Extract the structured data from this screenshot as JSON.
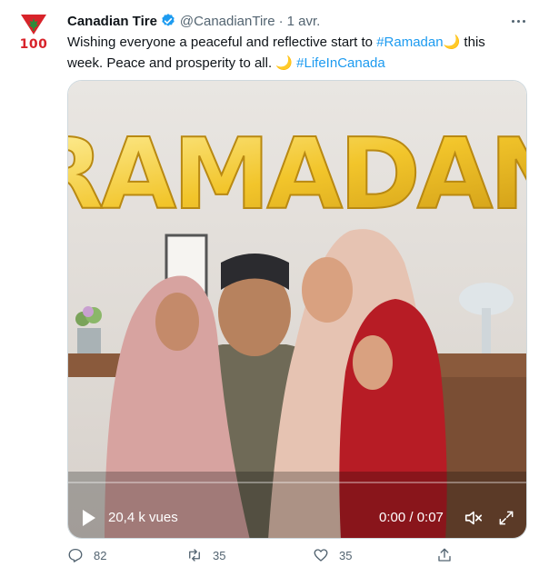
{
  "tweet": {
    "author": {
      "display_name": "Canadian Tire",
      "handle": "@CanadianTire",
      "avatar_text": "100",
      "avatar_icon": "triangle-leaf-icon",
      "verified_icon": "verified-badge-icon"
    },
    "separator": "·",
    "timestamp": "1 avr.",
    "text": {
      "part1": "Wishing everyone a peaceful and reflective start to ",
      "hashtag1": "#Ramadan",
      "emoji1": "🌙",
      "part2": " this week. Peace and prosperity to all. ",
      "emoji2": "🌙",
      "hashtag2": "#LifeInCanada"
    },
    "more_icon": "more-horizontal-icon",
    "media": {
      "balloon_text": "RAMADAN",
      "views": "20,4 k vues",
      "timecode": "0:00 / 0:07",
      "progress": 0.0,
      "icons": {
        "play": "play-icon",
        "volume": "volume-icon",
        "fullscreen": "fullscreen-icon"
      }
    },
    "actions": {
      "reply": {
        "count": "82",
        "icon": "reply-icon"
      },
      "retweet": {
        "count": "35",
        "icon": "retweet-icon"
      },
      "like": {
        "count": "35",
        "icon": "like-icon"
      },
      "share": {
        "icon": "share-icon"
      }
    },
    "colors": {
      "brand_red": "#d8232a",
      "link_blue": "#1d9bf0",
      "muted": "#536471"
    }
  }
}
